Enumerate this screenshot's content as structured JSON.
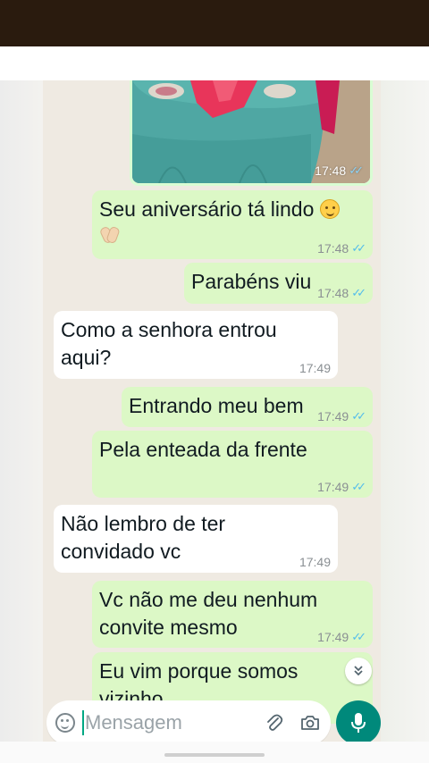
{
  "chat": {
    "image_message": {
      "time": "17:48",
      "status": "read"
    },
    "messages": [
      {
        "direction": "out",
        "text": "Seu aniversário tá lindo",
        "emojis": [
          "relieved-face-emoji",
          "clapping-hands-emoji"
        ],
        "time": "17:48",
        "status": "read"
      },
      {
        "direction": "out",
        "text": "Parabéns viu",
        "time": "17:48",
        "status": "read"
      },
      {
        "direction": "in",
        "line1": "Como a senhora entrou",
        "line2": "aqui?",
        "time": "17:49"
      },
      {
        "direction": "out",
        "text": "Entrando meu bem",
        "time": "17:49",
        "status": "read"
      },
      {
        "direction": "out",
        "text": "Pela enteada da frente",
        "time": "17:49",
        "status": "read"
      },
      {
        "direction": "in",
        "line1": "Não lembro de ter",
        "line2": "convidado vc",
        "time": "17:49"
      },
      {
        "direction": "out",
        "line1": "Vc não me deu nenhum",
        "line2": "convite mesmo",
        "time": "17:49",
        "status": "read"
      },
      {
        "direction": "out",
        "line1": "Eu vim porque somos",
        "line2": "vizinho",
        "status": "partially-visible"
      }
    ]
  },
  "composer": {
    "placeholder": "Mensagem",
    "icons": [
      "emoji-icon",
      "attach-icon",
      "camera-icon",
      "microphone-icon"
    ]
  },
  "colors": {
    "outgoing_bubble": "#dcf8c6",
    "incoming_bubble": "#ffffff",
    "chat_background": "#efeae2",
    "read_ticks": "#53bdeb",
    "mic_button": "#00897b",
    "top_bar": "#2a1b0e"
  }
}
